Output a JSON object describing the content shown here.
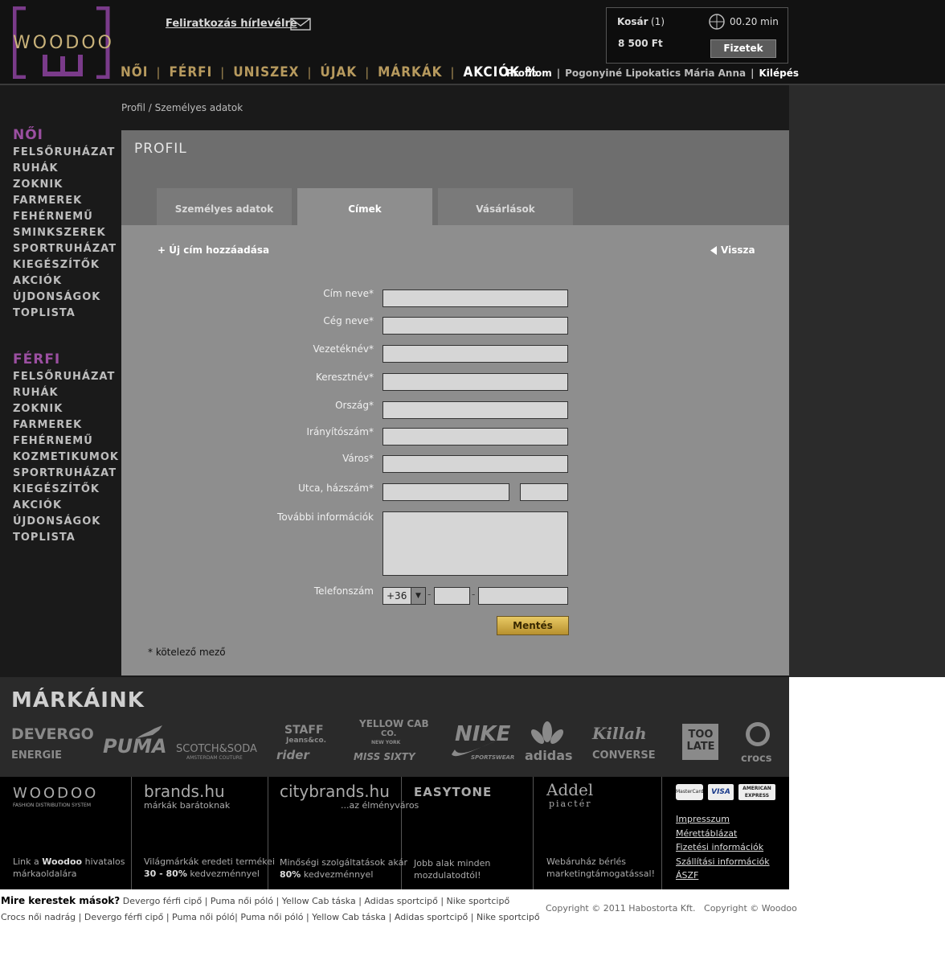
{
  "header": {
    "logo_text": "WOODOO",
    "newsletter_label": "Feliratkozás hírlevélre",
    "cart": {
      "label": "Kosár",
      "count": "(1)",
      "total": "8 500 Ft",
      "timer": "00.20 min",
      "pay_label": "Fizetek"
    },
    "nav": [
      "NŐI",
      "FÉRFI",
      "UNISZEX",
      "ÚJAK",
      "MÁRKÁK",
      "AKCIÓK %"
    ],
    "user": {
      "profile": "Profilom",
      "name": "Pogonyiné Lipokatics Mária Anna",
      "logout": "Kilépés"
    }
  },
  "breadcrumb": "Profil / Személyes adatok",
  "sidebar": {
    "women": {
      "title": "NŐI",
      "items": [
        "FELSŐRUHÁZAT",
        "RUHÁK",
        "ZOKNIK",
        "FARMEREK",
        "FEHÉRNEMŰ",
        "SMINKSZEREK",
        "SPORTRUHÁZAT",
        "KIEGÉSZÍTŐK",
        "AKCIÓK",
        "ÚJDONSÁGOK",
        "TOPLISTA"
      ]
    },
    "men": {
      "title": "FÉRFI",
      "items": [
        "FELSŐRUHÁZAT",
        "RUHÁK",
        "ZOKNIK",
        "FARMEREK",
        "FEHÉRNEMŰ",
        "KOZMETIKUMOK",
        "SPORTRUHÁZAT",
        "KIEGÉSZÍTŐK",
        "AKCIÓK",
        "ÚJDONSÁGOK",
        "TOPLISTA"
      ]
    }
  },
  "panel": {
    "title": "PROFIL",
    "tabs": [
      "Személyes adatok",
      "Címek",
      "Vásárlások"
    ],
    "active_tab": "Címek",
    "add_address": "+ Új cím hozzáadása",
    "back": "Vissza",
    "labels": {
      "address_name": "Cím neve*",
      "company": "Cég neve*",
      "surname": "Vezetéknév*",
      "firstname": "Keresztnév*",
      "country": "Ország*",
      "zip": "Irányítószám*",
      "city": "Város*",
      "street": "Utca, házszám*",
      "notes": "További információk",
      "phone": "Telefonszám"
    },
    "phone_prefix": "+36",
    "phone_sep": "-",
    "save": "Mentés",
    "required_note": "* kötelező mező"
  },
  "brands": {
    "title": "MÁRKÁINK",
    "items": [
      "DEVERGO",
      "ENERGIE",
      "PUMA",
      "SCOTCH&SODA",
      "AMSTERDAM COUTURE",
      "STAFF",
      "Jeans&co.",
      "rider",
      "YELLOW CAB",
      "CO.",
      "NEW YORK",
      "MISS SIXTY",
      "NIKE",
      "SPORTSWEAR",
      "adidas",
      "Killah",
      "CONVERSE",
      "TOO LATE",
      "crocs"
    ]
  },
  "footer": {
    "cols": [
      {
        "title": "WOODOO",
        "subtitle": "FASHION DISTRIBUTION SYSTEM",
        "text1": "Link a ",
        "bold": "Woodoo",
        "text2": " hivatalos",
        "text3": "márkaoldalára"
      },
      {
        "title": "brands.hu",
        "subtitle": "márkák barátoknak",
        "text1": "Világmárkák eredeti termékei",
        "bold": "30 - 80%",
        "text2": " kedvezménnyel"
      },
      {
        "title": "citybrands.hu",
        "subtitle": "...az élményváros",
        "text1": "Minőségi szolgáltatások akár",
        "bold": "80%",
        "text2": " kedvezménnyel"
      },
      {
        "title": "EASYTONE",
        "text1": "Jobb alak minden",
        "text2": "mozdulatodtól!"
      },
      {
        "title": "Addel",
        "subtitle": "piactér",
        "text1": "Webáruház bérlés",
        "text2": "marketingtámogatással!"
      }
    ],
    "cards": [
      "MasterCard",
      "VISA",
      "AMERICAN EXPRESS"
    ],
    "links": [
      "Impresszum",
      "Mérettáblázat",
      "Fizetési információk",
      "Szállítási információk",
      "ÁSZF"
    ]
  },
  "bottom": {
    "question": "Mire kerestek mások?",
    "row1": [
      "Devergo férfi cipő",
      "Puma női póló",
      "Yellow Cab táska",
      "Adidas sportcipő",
      "Nike sportcipő"
    ],
    "row2": [
      "Crocs női nadrág",
      "Devergo férfi cipő",
      "Puma női póló",
      "Puma női póló",
      "Yellow Cab táska",
      "Adidas sportcipő",
      "Nike sportcipő"
    ],
    "copyright1": "Copyright © 2011 Habostorta Kft.",
    "copyright2": "Copyright © Woodoo"
  }
}
